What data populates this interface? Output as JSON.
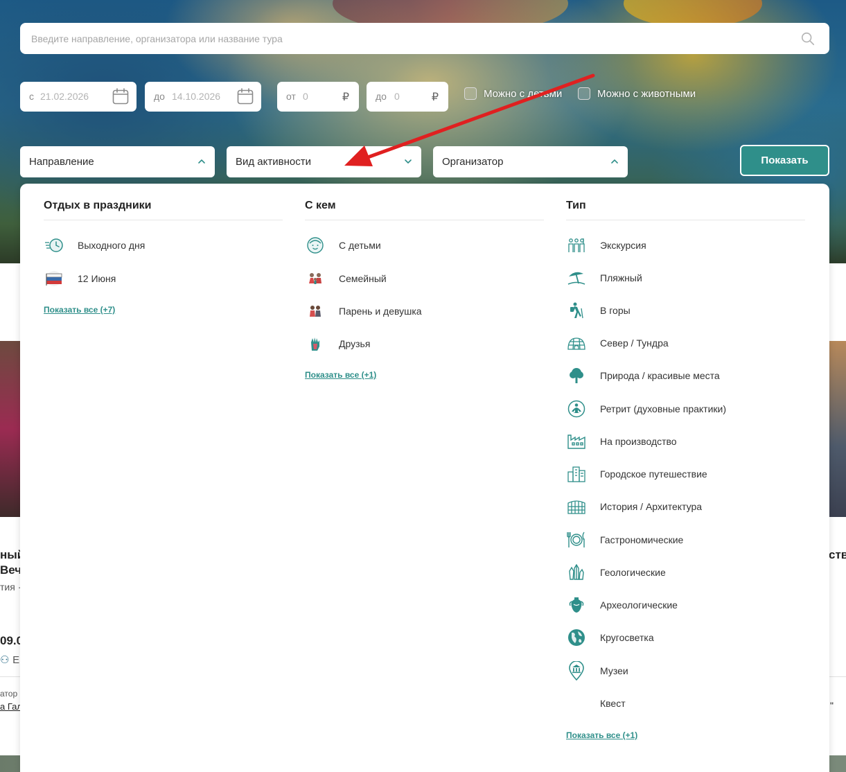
{
  "search": {
    "placeholder": "Введите направление, организатора или название тура"
  },
  "filters": {
    "date_from_prefix": "с",
    "date_from_value": "21.02.2026",
    "date_to_prefix": "до",
    "date_to_value": "14.10.2026",
    "price_from_prefix": "от",
    "price_from_value": "0",
    "price_to_prefix": "до",
    "price_to_value": "0",
    "currency": "₽",
    "with_kids": "Можно с детьми",
    "with_pets": "Можно с животными"
  },
  "selects": {
    "direction": "Направление",
    "activity": "Вид активности",
    "organizer": "Организатор",
    "show_button": "Показать"
  },
  "panel": {
    "col1": {
      "title": "Отдых в праздники",
      "items": [
        {
          "label": "Выходного дня",
          "icon": "clock-speed-icon"
        },
        {
          "label": "12 Июня",
          "icon": "russia-flag-icon"
        }
      ],
      "more": "Показать все (+7)"
    },
    "col2": {
      "title": "С кем",
      "items": [
        {
          "label": "С детьми",
          "icon": "child-face-icon"
        },
        {
          "label": "Семейный",
          "icon": "family-icon"
        },
        {
          "label": "Парень и девушка",
          "icon": "couple-icon"
        },
        {
          "label": "Друзья",
          "icon": "friends-hand-icon"
        }
      ],
      "more": "Показать все (+1)"
    },
    "col3": {
      "title": "Тип",
      "items": [
        {
          "label": "Экскурсия",
          "icon": "excursion-icon"
        },
        {
          "label": "Пляжный",
          "icon": "beach-umbrella-icon"
        },
        {
          "label": "В горы",
          "icon": "hiker-icon"
        },
        {
          "label": "Север / Тундра",
          "icon": "igloo-icon"
        },
        {
          "label": "Природа / красивые места",
          "icon": "tree-icon"
        },
        {
          "label": "Ретрит (духовные практики)",
          "icon": "meditation-icon"
        },
        {
          "label": "На производство",
          "icon": "factory-icon"
        },
        {
          "label": "Городское путешествие",
          "icon": "city-buildings-icon"
        },
        {
          "label": "История / Архитектура",
          "icon": "colosseum-icon"
        },
        {
          "label": "Гастрономические",
          "icon": "plate-cutlery-icon"
        },
        {
          "label": "Геологические",
          "icon": "crystals-icon"
        },
        {
          "label": "Археологические",
          "icon": "amphora-icon"
        },
        {
          "label": "Кругосветка",
          "icon": "globe-icon"
        },
        {
          "label": "Музеи",
          "icon": "museum-pin-icon"
        },
        {
          "label": "Квест",
          "icon": ""
        }
      ],
      "more": "Показать все (+1)"
    }
  },
  "background": {
    "left_card_line1": "ный",
    "left_card_line2": "Вече",
    "left_card_small": "тия ·",
    "left_card_date": "09.0",
    "left_card_people": "Е",
    "left_card_org": "атор",
    "left_card_org_link": "а Гал",
    "right_card_title": "ств",
    "right_card_link": "\""
  },
  "colors": {
    "accent": "#2f8f8a",
    "arrow": "#e02020"
  }
}
